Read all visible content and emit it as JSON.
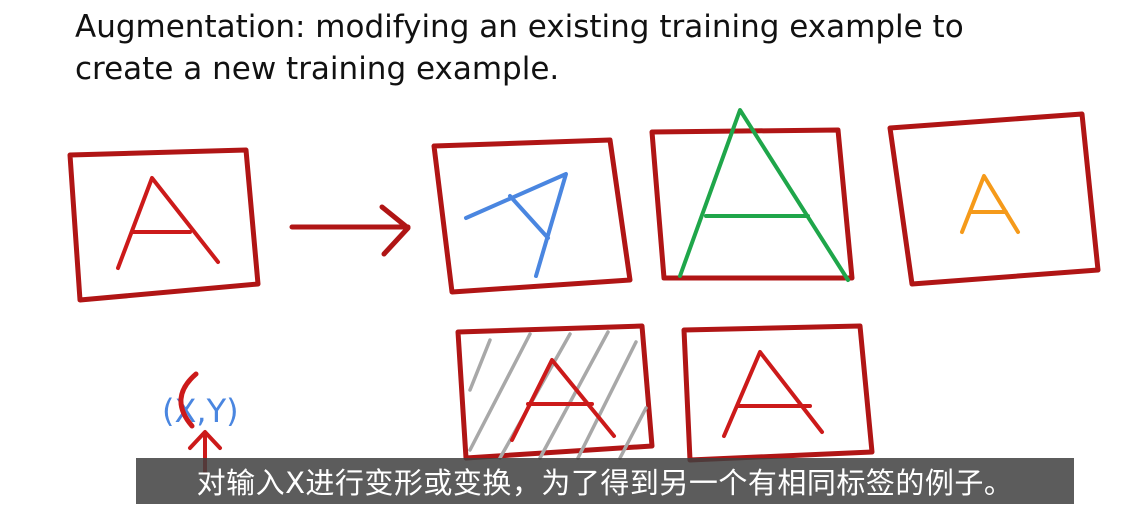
{
  "title": {
    "line1": "Augmentation: modifying an existing training example to",
    "line2": "create a new training example."
  },
  "xy_label": "(X,Y)",
  "subtitle": "对输入X进行变形或变换，为了得到另一个有相同标签的例子。",
  "colors": {
    "frame": "#b01515",
    "letter_red": "#cc1a1a",
    "letter_blue": "#4a86e0",
    "letter_green": "#1fa64a",
    "letter_orange": "#f59a1a",
    "hatch_gray": "#a8a8a8",
    "subtitle_bg": "#404040",
    "subtitle_text": "#ffffff"
  }
}
